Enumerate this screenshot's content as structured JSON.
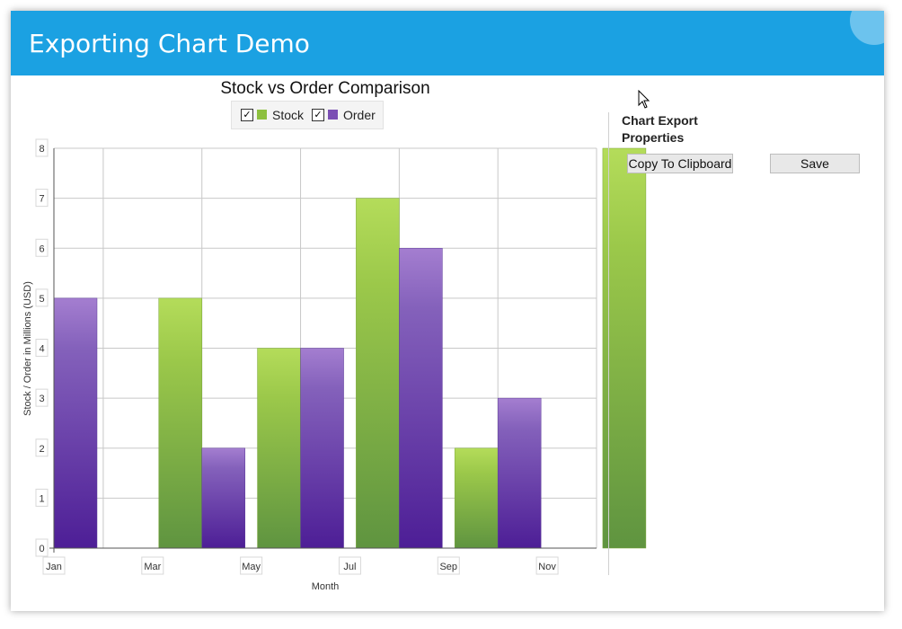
{
  "window": {
    "title": "Exporting Chart Demo",
    "close_glyph": "×"
  },
  "chart_data": {
    "type": "bar",
    "title": "Stock vs Order Comparison",
    "categories": [
      "Jan",
      "Mar",
      "May",
      "Jul",
      "Sep",
      "Nov"
    ],
    "series": [
      {
        "name": "Stock",
        "values": [
          null,
          5,
          4,
          7,
          2,
          8
        ],
        "color": "#8dc03f"
      },
      {
        "name": "Order",
        "values": [
          5,
          2,
          4,
          6,
          3,
          null
        ],
        "color": "#7b4fb4"
      }
    ],
    "xlabel": "Month",
    "ylabel": "Stock / Order in Millions (USD)",
    "ylim": [
      0,
      8
    ],
    "yticks": [
      "0",
      "1",
      "2",
      "3",
      "4",
      "5",
      "6",
      "7",
      "8"
    ],
    "grid": true,
    "legend_position": "top-center"
  },
  "legend": {
    "items": [
      {
        "label": "Stock",
        "checked": true,
        "checkmark": "✓",
        "color": "#8dc03f"
      },
      {
        "label": "Order",
        "checked": true,
        "checkmark": "✓",
        "color": "#7b4fb4"
      }
    ]
  },
  "properties_panel": {
    "title": "Chart Export Properties",
    "copy_button_label": "Copy To Clipboard",
    "save_button_label": "Save"
  }
}
